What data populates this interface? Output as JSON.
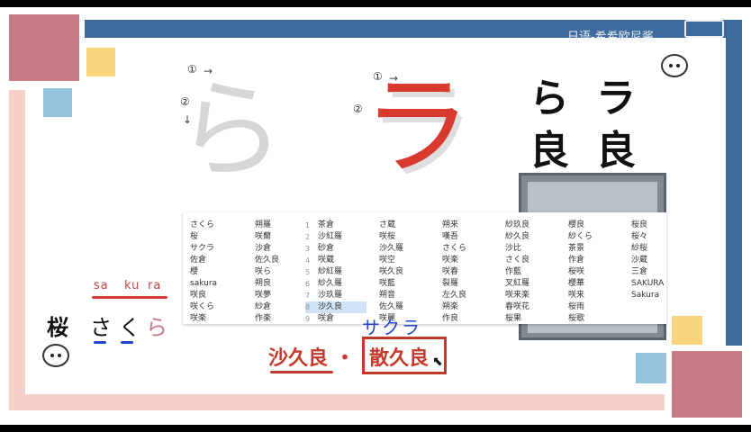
{
  "watermark": "日语-希希欧尼酱",
  "colors": {
    "rose": "#c77b84",
    "pink": "#f6cfcb",
    "blue": "#3d6b9e",
    "light_blue": "#96c3de",
    "yellow": "#fbd47e",
    "answer_red": "#c23a2b",
    "hand_blue": "#2244cc"
  },
  "stroke_marks": [
    "①",
    "②",
    "①",
    "②"
  ],
  "hiragana_big": "ら",
  "katakana_big": "ラ",
  "reference": {
    "row1": [
      "ら",
      "ラ"
    ],
    "row2": [
      "良",
      "良"
    ]
  },
  "ime": {
    "col1": [
      "さくら",
      "桜",
      "サクラ",
      "佐倉",
      "櫻",
      "sakura",
      "咲良",
      "咲くら",
      "咲楽"
    ],
    "col2": [
      "朔羅",
      "咲蘭",
      "沙倉",
      "佐久良",
      "咲ら",
      "朔良",
      "咲夢",
      "紗倉",
      "作楽"
    ],
    "col3_numbers": [
      "1",
      "2",
      "3",
      "4",
      "5",
      "6",
      "7",
      "8",
      "9"
    ],
    "col3": [
      "茶倉",
      "沙紅羅",
      "砂倉",
      "咲蔵",
      "紗紅羅",
      "紗久羅",
      "沙玖羅",
      "沙久良",
      "咲倉"
    ],
    "col4": [
      "さ蔵",
      "咲桜",
      "沙久羅",
      "咲空",
      "咲久良",
      "咲藍",
      "朔音",
      "佐久羅",
      "咲麗"
    ],
    "col5": [
      "朔来",
      "嘆吾",
      "さくら",
      "咲楽",
      "咲春",
      "裂羅",
      "左久良",
      "朔楽",
      "作良"
    ],
    "col6": [
      "紗玖良",
      "紗久良",
      "沙比",
      "さく良",
      "作藍",
      "叉紅羅",
      "咲来楽",
      "春咲花",
      "桜果"
    ],
    "col7": [
      "櫻良",
      "紗くら",
      "茶景",
      "作倉",
      "桜咲",
      "櫻華",
      "咲来",
      "桜雨",
      "桜歌"
    ],
    "col8": [
      "桜良",
      "桜々",
      "紗桜",
      "沙蔵",
      "三倉",
      "SAKURA",
      "Sakura"
    ],
    "selected_index": 7
  },
  "romaji": [
    "sa",
    "ku",
    "ra"
  ],
  "word_kanji": "桜",
  "word_kana": [
    "さ",
    "く",
    "ら"
  ],
  "handwritten_katakana": "サクラ",
  "answer": {
    "left": "沙久良",
    "separator": "・",
    "right": "散久良"
  }
}
